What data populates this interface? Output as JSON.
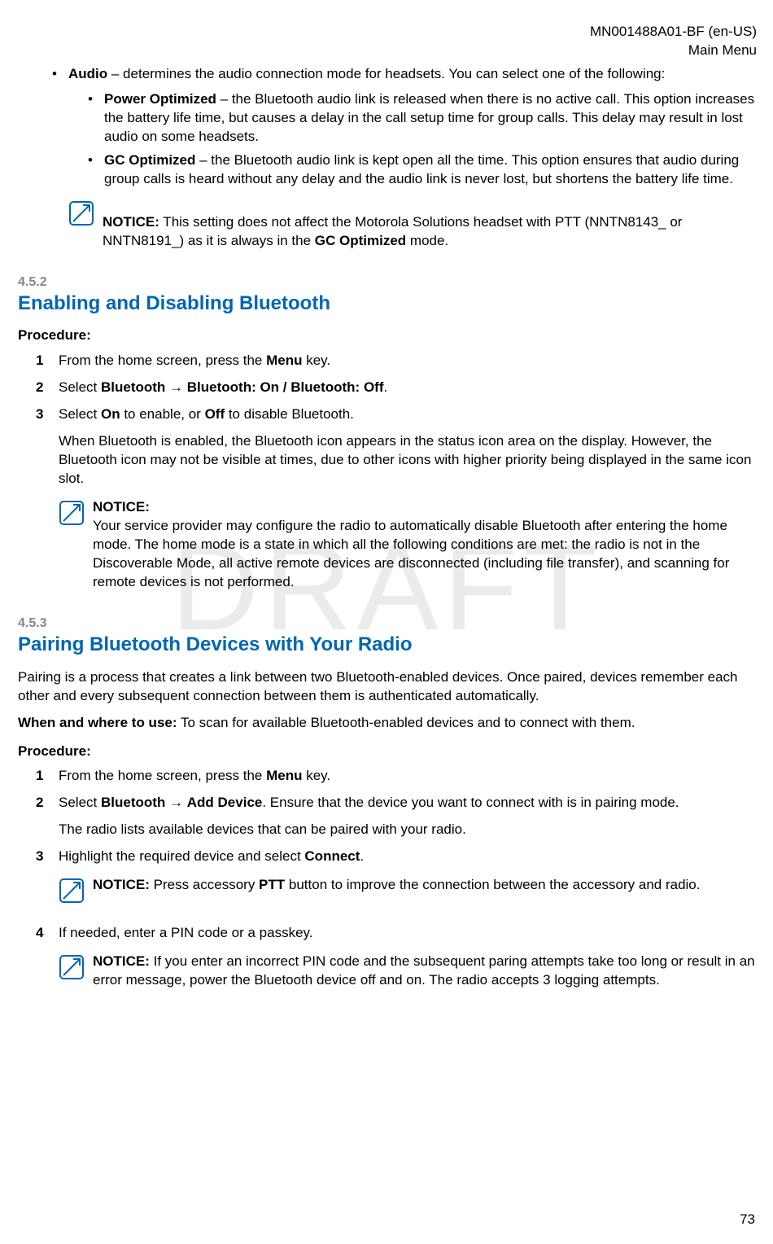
{
  "header": {
    "doc_id": "MN001488A01-BF (en-US)",
    "section": "Main Menu"
  },
  "watermark": "DRAFT",
  "audio_intro_label": "Audio",
  "audio_intro_text": " – determines the audio connection mode for headsets. You can select one of the following:",
  "audio_sub": [
    {
      "label": "Power Optimized",
      "text": " – the Bluetooth audio link is released when there is no active call. This option increases the battery life time, but causes a delay in the call setup time for group calls. This delay may result in lost audio on some headsets."
    },
    {
      "label": "GC Optimized",
      "text": " – the Bluetooth audio link is kept open all the time. This option ensures that audio during group calls is heard without any delay and the audio link is never lost, but shortens the battery life time."
    }
  ],
  "notice1_label": "NOTICE:",
  "notice1_pre": " This setting does not affect the Motorola Solutions headset with PTT (NNTN8143_ or NNTN8191_) as it is always in the ",
  "notice1_bold": "GC Optimized",
  "notice1_post": " mode.",
  "s452": {
    "num": "4.5.2",
    "title": "Enabling and Disabling Bluetooth",
    "procedure": "Procedure:",
    "steps": {
      "1_pre": "From the home screen, press the ",
      "1_bold": "Menu",
      "1_post": " key.",
      "2_pre": "Select ",
      "2_b1": "Bluetooth",
      "2_arrow": " → ",
      "2_b2": "Bluetooth: On / Bluetooth: Off",
      "2_post": ".",
      "3_pre": "Select ",
      "3_b1": "On",
      "3_mid": " to enable, or ",
      "3_b2": "Off",
      "3_post": " to disable Bluetooth.",
      "3_sub": "When Bluetooth is enabled, the Bluetooth icon appears in the status icon area on the display. However, the Bluetooth icon may not be visible at times, due to other icons with higher priority being displayed in the same icon slot."
    },
    "notice_label": "NOTICE:",
    "notice_text": "Your service provider may configure the radio to automatically disable Bluetooth after entering the home mode. The home mode is a state in which all the following conditions are met: the radio is not in the Discoverable Mode, all active remote devices are disconnected (including file transfer), and scanning for remote devices is not performed."
  },
  "s453": {
    "num": "4.5.3",
    "title": "Pairing Bluetooth Devices with Your Radio",
    "intro": "Pairing is a process that creates a link between two Bluetooth-enabled devices. Once paired, devices remember each other and every subsequent connection between them is authenticated automatically.",
    "when_label": "When and where to use:",
    "when_text": " To scan for available Bluetooth-enabled devices and to connect with them.",
    "procedure": "Procedure:",
    "steps": {
      "1_pre": "From the home screen, press the ",
      "1_bold": "Menu",
      "1_post": " key.",
      "2_pre": "Select ",
      "2_b1": "Bluetooth",
      "2_arrow": " → ",
      "2_b2": "Add Device",
      "2_post": ". Ensure that the device you want to connect with is in pairing mode.",
      "2_sub": "The radio lists available devices that can be paired with your radio.",
      "3_pre": "Highlight the required device and select ",
      "3_bold": "Connect",
      "3_post": ".",
      "notice3_label": "NOTICE:",
      "notice3_pre": " Press accessory ",
      "notice3_bold": "PTT",
      "notice3_post": " button to improve the connection between the accessory and radio.",
      "4_text": "If needed, enter a PIN code or a passkey.",
      "notice4_label": "NOTICE:",
      "notice4_text": " If you enter an incorrect PIN code and the subsequent paring attempts take too long or result in an error message, power the Bluetooth device off and on. The radio accepts 3 logging attempts."
    }
  },
  "page_number": "73"
}
